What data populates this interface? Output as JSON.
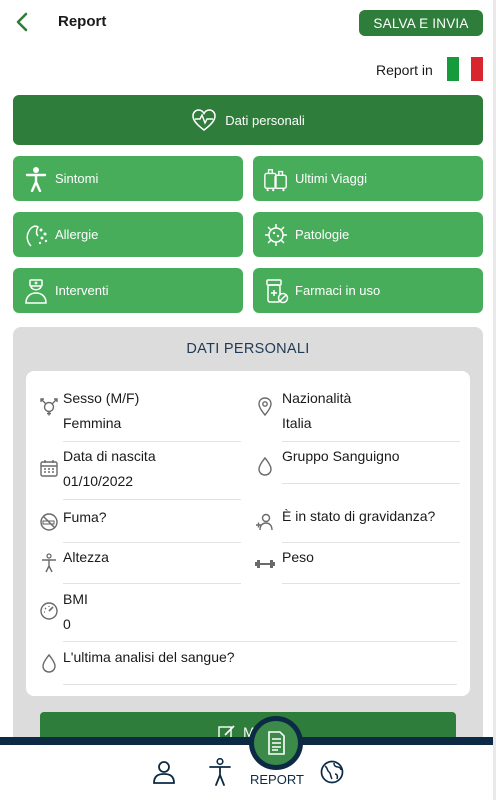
{
  "header": {
    "title": "Report",
    "save_label": "SALVA E INVIA"
  },
  "language": {
    "label": "Report in",
    "flag_colors": [
      "#169b3c",
      "#ffffff",
      "#d8262f"
    ]
  },
  "primary_button": {
    "label": "Dati personali",
    "icon": "heart-pulse-icon"
  },
  "sections": [
    {
      "label": "Sintomi",
      "icon": "person-icon"
    },
    {
      "label": "Ultimi Viaggi",
      "icon": "luggage-icon"
    },
    {
      "label": "Allergie",
      "icon": "allergy-icon"
    },
    {
      "label": "Patologie",
      "icon": "virus-icon"
    },
    {
      "label": "Interventi",
      "icon": "doctor-icon"
    },
    {
      "label": "Farmaci in uso",
      "icon": "pill-bottle-icon"
    }
  ],
  "panel": {
    "title": "DATI PERSONALI",
    "fields": {
      "sex": {
        "label": "Sesso (M/F)",
        "value": "Femmina"
      },
      "nationality": {
        "label": "Nazionalità",
        "value": "Italia"
      },
      "birthdate": {
        "label": "Data di nascita",
        "value": "01/10/2022"
      },
      "blood_group": {
        "label": "Gruppo Sanguigno",
        "value": ""
      },
      "smoke": {
        "label": "Fuma?",
        "value": ""
      },
      "pregnancy": {
        "label": "È in stato di gravidanza?",
        "value": ""
      },
      "height": {
        "label": "Altezza",
        "value": ""
      },
      "weight": {
        "label": "Peso",
        "value": ""
      },
      "bmi": {
        "label": "BMI",
        "value": "0"
      },
      "blood_test": {
        "label": "L'ultima analisi del sangue?",
        "value": ""
      }
    },
    "edit_label": "MOD"
  },
  "nav": {
    "items": [
      "profile-icon",
      "body-icon",
      "report-icon",
      "globe-icon"
    ],
    "active_label": "REPORT"
  },
  "colors": {
    "dark_green": "#2f7d3a",
    "green": "#47ad5a",
    "navy": "#0d2a44",
    "panel_bg": "#dcdcdc"
  }
}
